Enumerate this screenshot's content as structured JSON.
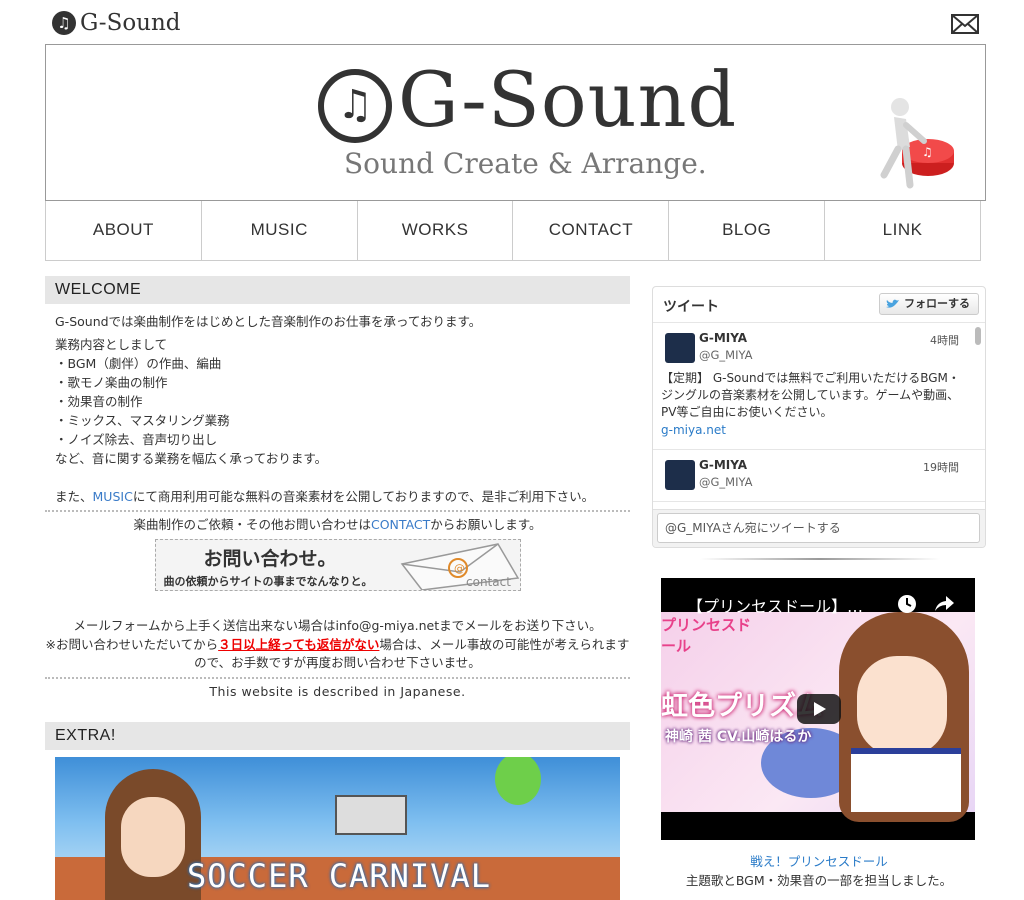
{
  "header": {
    "small_logo": "G-Sound",
    "logo_mark": "♫",
    "mail_icon": "mail-icon"
  },
  "banner": {
    "title": "G-Sound",
    "tagline": "Sound Create & Arrange.",
    "mark": "♫"
  },
  "nav": {
    "items": [
      {
        "label": "ABOUT"
      },
      {
        "label": "MUSIC"
      },
      {
        "label": "WORKS"
      },
      {
        "label": "CONTACT"
      },
      {
        "label": "BLOG"
      },
      {
        "label": "LINK"
      }
    ]
  },
  "welcome": {
    "heading": "WELCOME",
    "intro": "G-Soundでは楽曲制作をはじめとした音楽制作のお仕事を承っております。",
    "lines": [
      "業務内容としまして",
      "・BGM（劇伴）の作曲、編曲",
      "・歌モノ楽曲の制作",
      "・効果音の制作",
      "・ミックス、マスタリング業務",
      "・ノイズ除去、音声切り出し",
      "など、音に関する業務を幅広く承っております。"
    ],
    "music_pre": "また、",
    "music_link": "MUSIC",
    "music_post": "にて商用利用可能な無料の音楽素材を公開しておりますので、是非ご利用下さい。",
    "contact_pre": "楽曲制作のご依頼・その他お問い合わせは",
    "contact_link": "CONTACT",
    "contact_post": "からお願いします。",
    "contact_banner_title": "お問い合わせ。",
    "contact_banner_sub": "曲の依頼からサイトの事までなんなりと。",
    "contact_banner_env": "contact",
    "note1": "メールフォームから上手く送信出来ない場合はinfo@g-miya.netまでメールをお送り下さい。",
    "note2_pre": "※お問い合わせいただいてから",
    "note2_warn": "３日以上経っても返信がない",
    "note2_post": "場合は、メール事故の可能性が考えられますので、お手数ですが再度お問い合わせ下さいませ。",
    "lang_note": "This website is described in Japanese."
  },
  "extra": {
    "heading": "EXTRA!",
    "image_title": "SOCCER CARNIVAL"
  },
  "twitter": {
    "title": "ツイート",
    "follow": "フォローする",
    "tweets": [
      {
        "name": "G-MIYA",
        "handle": "@G_MIYA",
        "time": "4時間",
        "body": "【定期】 G-Soundでは無料でご利用いただけるBGM・ジングルの音楽素材を公開しています。ゲームや動画、PV等ご自由にお使いください。",
        "url": "g-miya.net"
      },
      {
        "name": "G-MIYA",
        "handle": "@G_MIYA",
        "time": "19時間"
      }
    ],
    "compose": "@G_MIYAさん宛にツイートする"
  },
  "video": {
    "title": "【プリンセスドール】…",
    "logo": "プリンセスドール",
    "rainbow": "虹色プリズム",
    "cv": "神崎 茜  CV.山崎はるか",
    "caption_link": "戦え！プリンセスドール",
    "caption_text": "主題歌とBGM・効果音の一部を担当しました。"
  },
  "colors": {
    "link": "#3a7bc8",
    "warn": "#ee0000",
    "section_bg": "#e6e6e6"
  }
}
